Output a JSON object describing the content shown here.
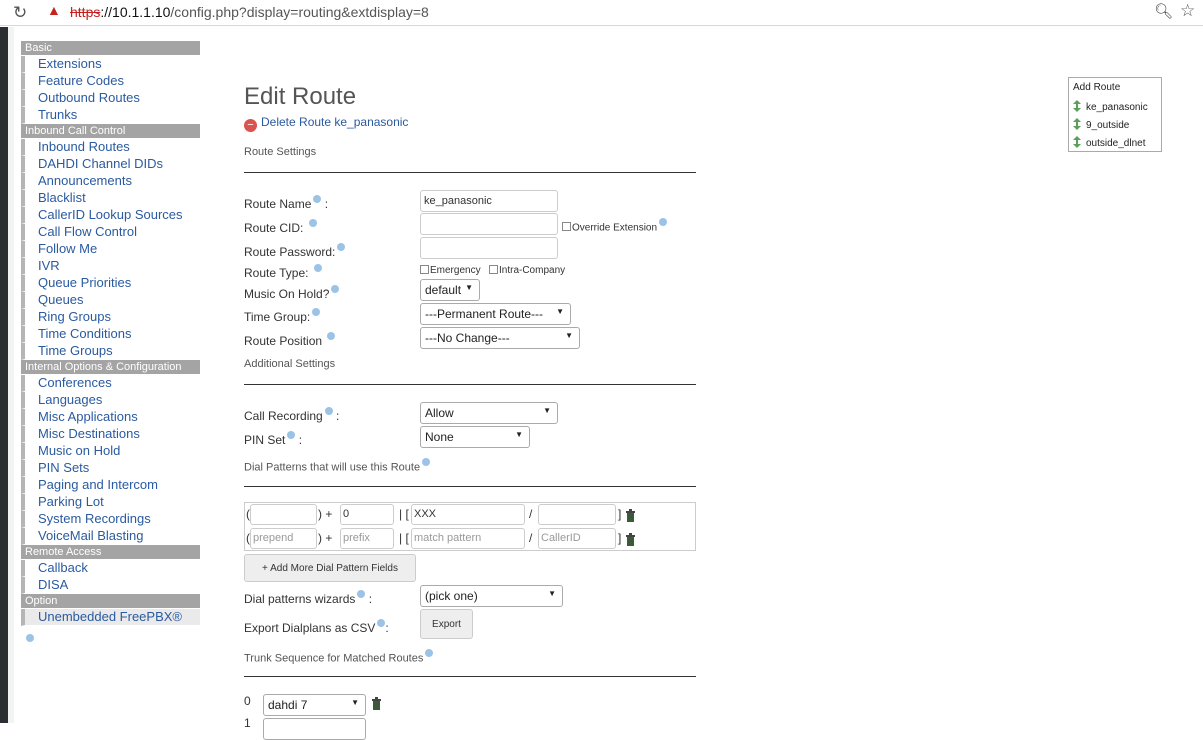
{
  "browser": {
    "url_scheme": "https",
    "url_host": "10.1.1.10",
    "url_path": "/config.php?display=routing&extdisplay=8"
  },
  "sidebar": {
    "sections": [
      {
        "header": "Basic",
        "items": [
          "Extensions",
          "Feature Codes",
          "Outbound Routes",
          "Trunks"
        ]
      },
      {
        "header": "Inbound Call Control",
        "items": [
          "Inbound Routes",
          "DAHDI Channel DIDs",
          "Announcements",
          "Blacklist",
          "CallerID Lookup Sources",
          "Call Flow Control",
          "Follow Me",
          "IVR",
          "Queue Priorities",
          "Queues",
          "Ring Groups",
          "Time Conditions",
          "Time Groups"
        ]
      },
      {
        "header": "Internal Options & Configuration",
        "items": [
          "Conferences",
          "Languages",
          "Misc Applications",
          "Misc Destinations",
          "Music on Hold",
          "PIN Sets",
          "Paging and Intercom",
          "Parking Lot",
          "System Recordings",
          "VoiceMail Blasting"
        ]
      },
      {
        "header": "Remote Access",
        "items": [
          "Callback",
          "DISA"
        ]
      },
      {
        "header": "Option",
        "items": [
          "Unembedded FreePBX®"
        ]
      }
    ]
  },
  "main": {
    "title": "Edit Route",
    "delete_link": "Delete Route ke_panasonic",
    "route_settings_title": "Route Settings",
    "route_name_label": "Route Name",
    "route_name_value": "ke_panasonic",
    "route_cid_label": "Route CID:",
    "override_extension_label": "Override Extension",
    "route_password_label": "Route Password:",
    "route_type_label": "Route Type:",
    "emergency_label": "Emergency",
    "intra_company_label": "Intra-Company",
    "music_on_hold_label": "Music On Hold?",
    "music_on_hold_value": "default",
    "time_group_label": "Time Group:",
    "time_group_value": "---Permanent Route---",
    "route_position_label": "Route Position",
    "route_position_value": "---No Change---",
    "additional_settings_title": "Additional Settings",
    "call_recording_label": "Call Recording",
    "call_recording_value": "Allow",
    "pin_set_label": "PIN Set",
    "pin_set_value": "None",
    "dial_patterns_title": "Dial Patterns that will use this Route",
    "dial_patterns": {
      "row1": {
        "prepend": "",
        "prefix": "0",
        "match": "XXX",
        "callerid": ""
      },
      "row2": {
        "prepend_ph": "prepend",
        "prefix_ph": "prefix",
        "match_ph": "match pattern",
        "callerid_ph": "CallerID"
      }
    },
    "add_more_button": "+ Add More Dial Pattern Fields",
    "wizards_label": "Dial patterns wizards",
    "wizards_value": "(pick one)",
    "export_label": "Export Dialplans as CSV",
    "export_button": "Export",
    "trunk_sequence_title": "Trunk Sequence for Matched Routes",
    "trunks": [
      {
        "index": "0",
        "value": "dahdi 7"
      },
      {
        "index": "1",
        "value": ""
      }
    ]
  },
  "route_list": {
    "add_route": "Add Route",
    "routes": [
      "ke_panasonic",
      "9_outside",
      "outside_dlnet"
    ]
  },
  "colors": {
    "link": "#2a5aa0",
    "section_header": "#a4a4a4",
    "delete": "#d9534f"
  }
}
